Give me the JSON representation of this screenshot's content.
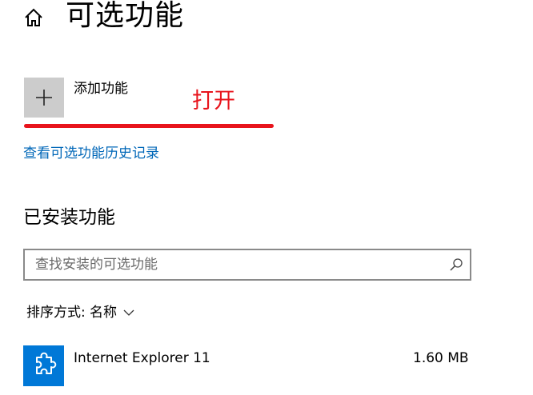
{
  "header": {
    "title": "可选功能",
    "home_icon": "home-icon"
  },
  "add_feature": {
    "label": "添加功能",
    "icon": "plus-icon",
    "button_color": "#cccccc"
  },
  "annotation": {
    "text": "打开",
    "color": "#e8141c"
  },
  "history_link": {
    "label": "查看可选功能历史记录",
    "color": "#0067b8"
  },
  "installed": {
    "section_title": "已安装功能",
    "search": {
      "placeholder": "查找安装的可选功能",
      "value": "",
      "icon": "search-icon"
    },
    "sort": {
      "label": "排序方式:",
      "value": "名称",
      "icon": "chevron-down-icon"
    },
    "features": [
      {
        "name": "Internet Explorer 11",
        "size": "1.60 MB",
        "icon": "puzzle-piece-icon",
        "tile_color": "#0078d7"
      }
    ]
  }
}
